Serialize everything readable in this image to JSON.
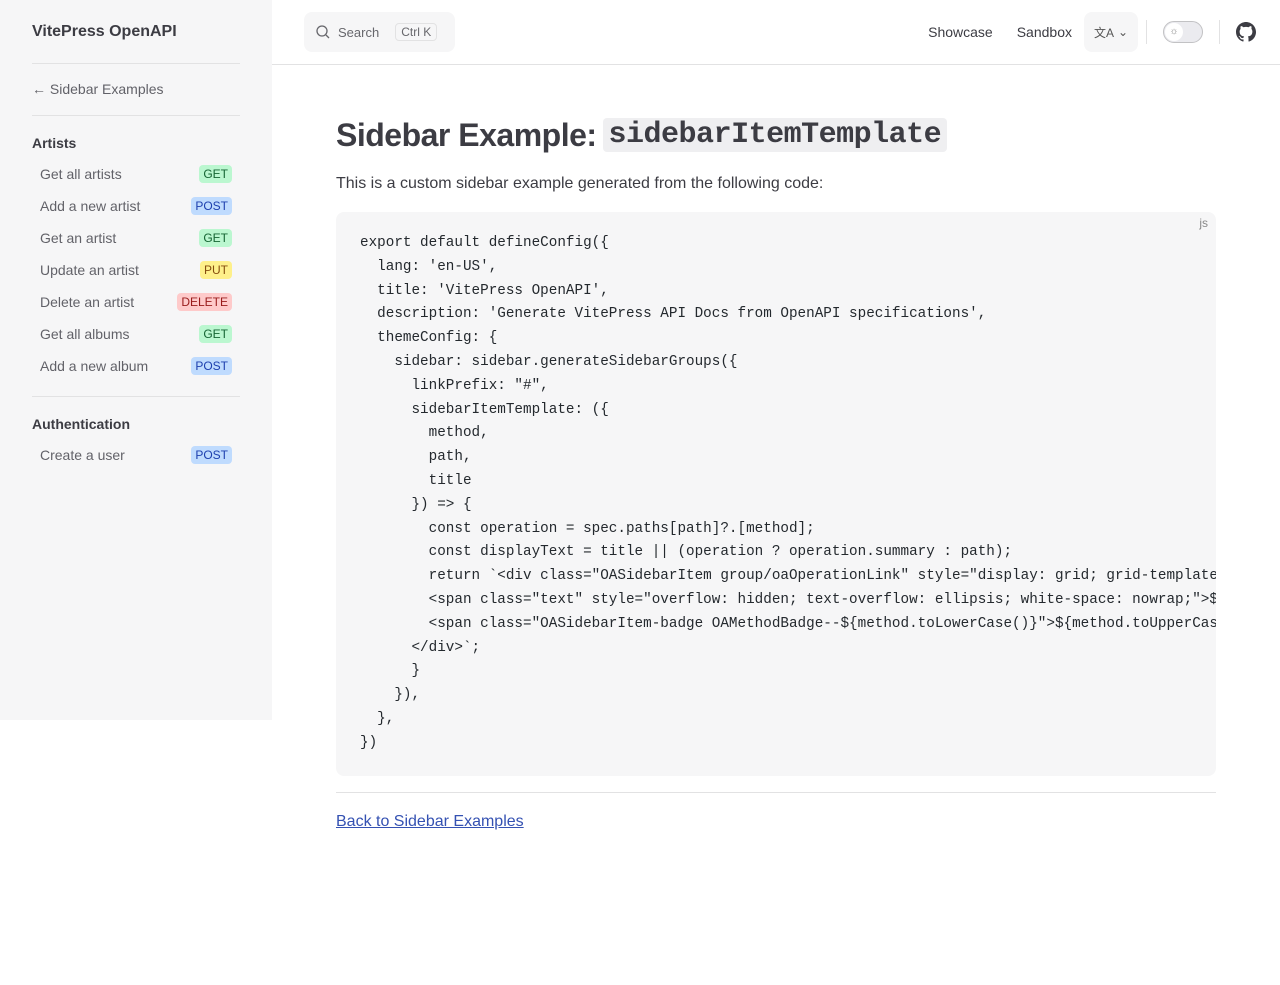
{
  "brand": "VitePress OpenAPI",
  "back": "← Sidebar Examples",
  "groups": [
    {
      "title": "Artists",
      "items": [
        {
          "label": "Get all artists",
          "method": "GET"
        },
        {
          "label": "Add a new artist",
          "method": "POST"
        },
        {
          "label": "Get an artist",
          "method": "GET"
        },
        {
          "label": "Update an artist",
          "method": "PUT"
        },
        {
          "label": "Delete an artist",
          "method": "DELETE"
        },
        {
          "label": "Get all albums",
          "method": "GET"
        },
        {
          "label": "Add a new album",
          "method": "POST"
        }
      ]
    },
    {
      "title": "Authentication",
      "items": [
        {
          "label": "Create a user",
          "method": "POST"
        }
      ]
    }
  ],
  "search": {
    "label": "Search",
    "kbd": "Ctrl K"
  },
  "nav": {
    "showcase": "Showcase",
    "sandbox": "Sandbox"
  },
  "title_prefix": "Sidebar Example:",
  "title_code": "sidebarItemTemplate",
  "intro": "This is a custom sidebar example generated from the following code:",
  "code_lang": "js",
  "code": "export default defineConfig({\n  lang: 'en-US',\n  title: 'VitePress OpenAPI',\n  description: 'Generate VitePress API Docs from OpenAPI specifications',\n  themeConfig: {\n    sidebar: sidebar.generateSidebarGroups({\n      linkPrefix: \"#\",\n      sidebarItemTemplate: ({\n        method,\n        path,\n        title\n      }) => {\n        const operation = spec.paths[path]?.[method];\n        const displayText = title || (operation ? operation.summary : path);\n        return `<div class=\"OASidebarItem group/oaOperationLink\" style=\"display: grid; grid-template-c\n        <span class=\"text\" style=\"overflow: hidden; text-overflow: ellipsis; white-space: nowrap;\">${d\n        <span class=\"OASidebarItem-badge OAMethodBadge--${method.toLowerCase()}\">${method.toUpperCase(\n      </div>`;\n      }\n    }),\n  },\n})",
  "back_link": "Back to Sidebar Examples"
}
